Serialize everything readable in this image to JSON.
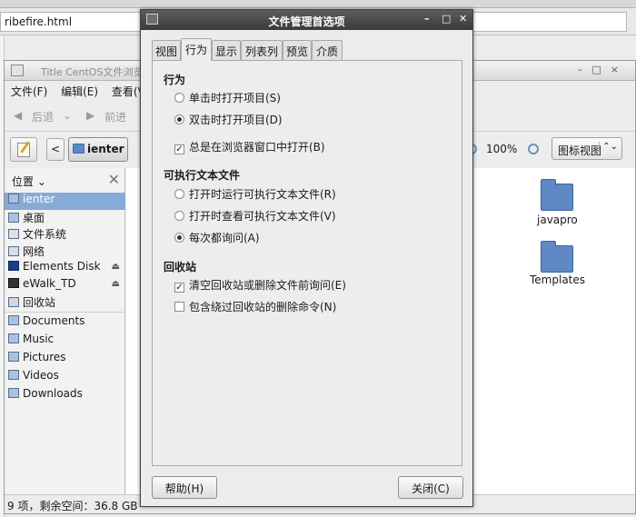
{
  "background": {
    "browser_url": "ribefire.html"
  },
  "nautilus": {
    "title": "Title CentOS文件浏览器",
    "menu": [
      "文件(F)",
      "编辑(E)",
      "查看(V)"
    ],
    "nav": {
      "back": "后退",
      "forward": "前进"
    },
    "breadcrumb": "ienter",
    "zoom": "100%",
    "view_mode": "图标视图",
    "sidebar_header": "位置",
    "places": [
      {
        "label": "ienter",
        "eject": false
      },
      {
        "label": "桌面",
        "eject": false
      },
      {
        "label": "文件系统",
        "eject": false
      },
      {
        "label": "网络",
        "eject": false
      },
      {
        "label": "Elements Disk",
        "eject": true
      },
      {
        "label": "eWalk_TD",
        "eject": true
      },
      {
        "label": "回收站",
        "eject": false
      }
    ],
    "bookmarks": [
      "Documents",
      "Music",
      "Pictures",
      "Videos",
      "Downloads"
    ],
    "files": [
      {
        "label": "javapro"
      },
      {
        "label": "Templates"
      }
    ],
    "status": "9 项，剩余空间：36.8 GB"
  },
  "dialog": {
    "title": "文件管理首选项",
    "tabs": [
      "视图",
      "行为",
      "显示",
      "列表列",
      "预览",
      "介质"
    ],
    "active_tab": "行为",
    "sections": {
      "behavior": {
        "heading": "行为",
        "single_click": "单击时打开项目(S)",
        "double_click": "双击时打开项目(D)",
        "browser_window": "总是在浏览器窗口中打开(B)"
      },
      "executable": {
        "heading": "可执行文本文件",
        "run": "打开时运行可执行文本文件(R)",
        "view": "打开时查看可执行文本文件(V)",
        "ask": "每次都询问(A)"
      },
      "trash": {
        "heading": "回收站",
        "ask_empty": "清空回收站或删除文件前询问(E)",
        "include_delete": "包含绕过回收站的删除命令(N)"
      }
    },
    "help_button": "帮助(H)",
    "close_button": "关闭(C)"
  }
}
